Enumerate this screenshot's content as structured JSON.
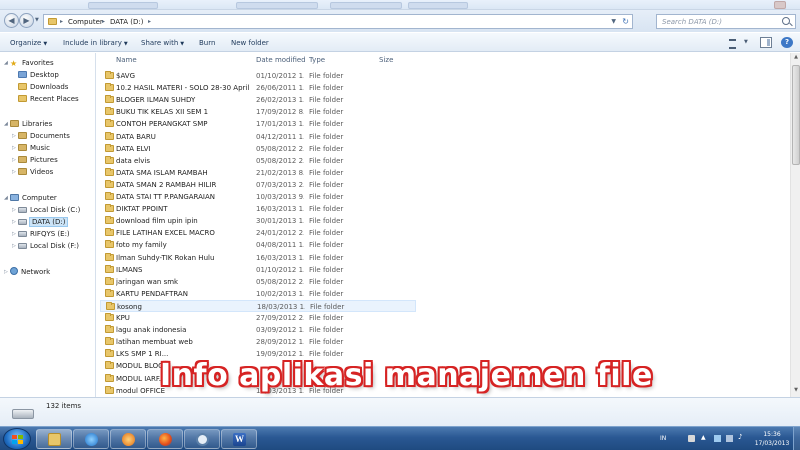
{
  "window": {
    "ghost_tabs": [
      "",
      "",
      "",
      ""
    ]
  },
  "address": {
    "crumbs": [
      "Computer",
      "DATA (D:)"
    ],
    "search_placeholder": "Search DATA (D:)"
  },
  "toolbar": {
    "organize": "Organize",
    "include": "Include in library",
    "share": "Share with",
    "burn": "Burn",
    "new_folder": "New folder"
  },
  "nav": {
    "favorites": "Favorites",
    "desktop": "Desktop",
    "downloads": "Downloads",
    "recent": "Recent Places",
    "libraries": "Libraries",
    "documents": "Documents",
    "music": "Music",
    "pictures": "Pictures",
    "videos": "Videos",
    "computer": "Computer",
    "local_c": "Local Disk (C:)",
    "data_d": "DATA (D:)",
    "rifqys_e": "RIFQYS (E:)",
    "local_f": "Local Disk (F:)",
    "network": "Network"
  },
  "columns": {
    "name": "Name",
    "date": "Date modified",
    "type": "Type",
    "size": "Size"
  },
  "files": [
    {
      "name": "$AVG",
      "date": "01/10/2012 1...",
      "type": "File folder"
    },
    {
      "name": "10.2 HASIL MATERI - SOLO 28-30 April",
      "date": "26/06/2011 1...",
      "type": "File folder"
    },
    {
      "name": "BLOGER ILMAN SUHDY",
      "date": "26/02/2013 1...",
      "type": "File folder"
    },
    {
      "name": "BUKU TIK KELAS XII SEM 1",
      "date": "17/09/2012 8...",
      "type": "File folder"
    },
    {
      "name": "CONTOH PERANGKAT SMP",
      "date": "17/01/2013 1...",
      "type": "File folder"
    },
    {
      "name": "DATA BARU",
      "date": "04/12/2011 1...",
      "type": "File folder"
    },
    {
      "name": "DATA ELVI",
      "date": "05/08/2012 2...",
      "type": "File folder"
    },
    {
      "name": "data elvis",
      "date": "05/08/2012 2...",
      "type": "File folder"
    },
    {
      "name": "DATA SMA ISLAM RAMBAH",
      "date": "21/02/2013 8...",
      "type": "File folder"
    },
    {
      "name": "DATA SMAN 2 RAMBAH HILIR",
      "date": "07/03/2013 2...",
      "type": "File folder"
    },
    {
      "name": "DATA STAI TT P.PANGARAIAN",
      "date": "10/03/2013 9...",
      "type": "File folder"
    },
    {
      "name": "DIKTAT PPOINT",
      "date": "16/03/2013 1...",
      "type": "File folder"
    },
    {
      "name": "download film upin ipin",
      "date": "30/01/2013 1...",
      "type": "File folder"
    },
    {
      "name": "FILE LATIHAN EXCEL MACRO",
      "date": "24/01/2012 2...",
      "type": "File folder"
    },
    {
      "name": "foto my family",
      "date": "04/08/2011 1...",
      "type": "File folder"
    },
    {
      "name": "Ilman Suhdy-TIK Rokan Hulu",
      "date": "16/03/2013 1...",
      "type": "File folder"
    },
    {
      "name": "ILMANS",
      "date": "01/10/2012 1...",
      "type": "File folder"
    },
    {
      "name": "jaringan wan smk",
      "date": "05/08/2012 2...",
      "type": "File folder"
    },
    {
      "name": "KARTU PENDAFTRAN",
      "date": "10/02/2013 1...",
      "type": "File folder"
    },
    {
      "name": "kosong",
      "date": "18/03/2013 1...",
      "type": "File folder"
    },
    {
      "name": "KPU",
      "date": "27/09/2012 2...",
      "type": "File folder"
    },
    {
      "name": "lagu anak indonesia",
      "date": "03/09/2012 1...",
      "type": "File folder"
    },
    {
      "name": "latihan membuat web",
      "date": "28/09/2012 1...",
      "type": "File folder"
    },
    {
      "name": "LKS SMP 1 RI...",
      "date": "19/09/2012 1...",
      "type": "File folder"
    },
    {
      "name": "MODUL BLOG...",
      "date": "",
      "type": ""
    },
    {
      "name": "MODUL IARF...",
      "date": "",
      "type": ""
    },
    {
      "name": "modul OFFICE",
      "date": "11/03/2013 1...",
      "type": "File folder"
    }
  ],
  "status": {
    "count": "132 items"
  },
  "caption": "Info aplikasi manajemen file",
  "taskbar": {
    "word_letter": "W",
    "lang": "IN",
    "time": "15:36",
    "date": "17/03/2013"
  }
}
